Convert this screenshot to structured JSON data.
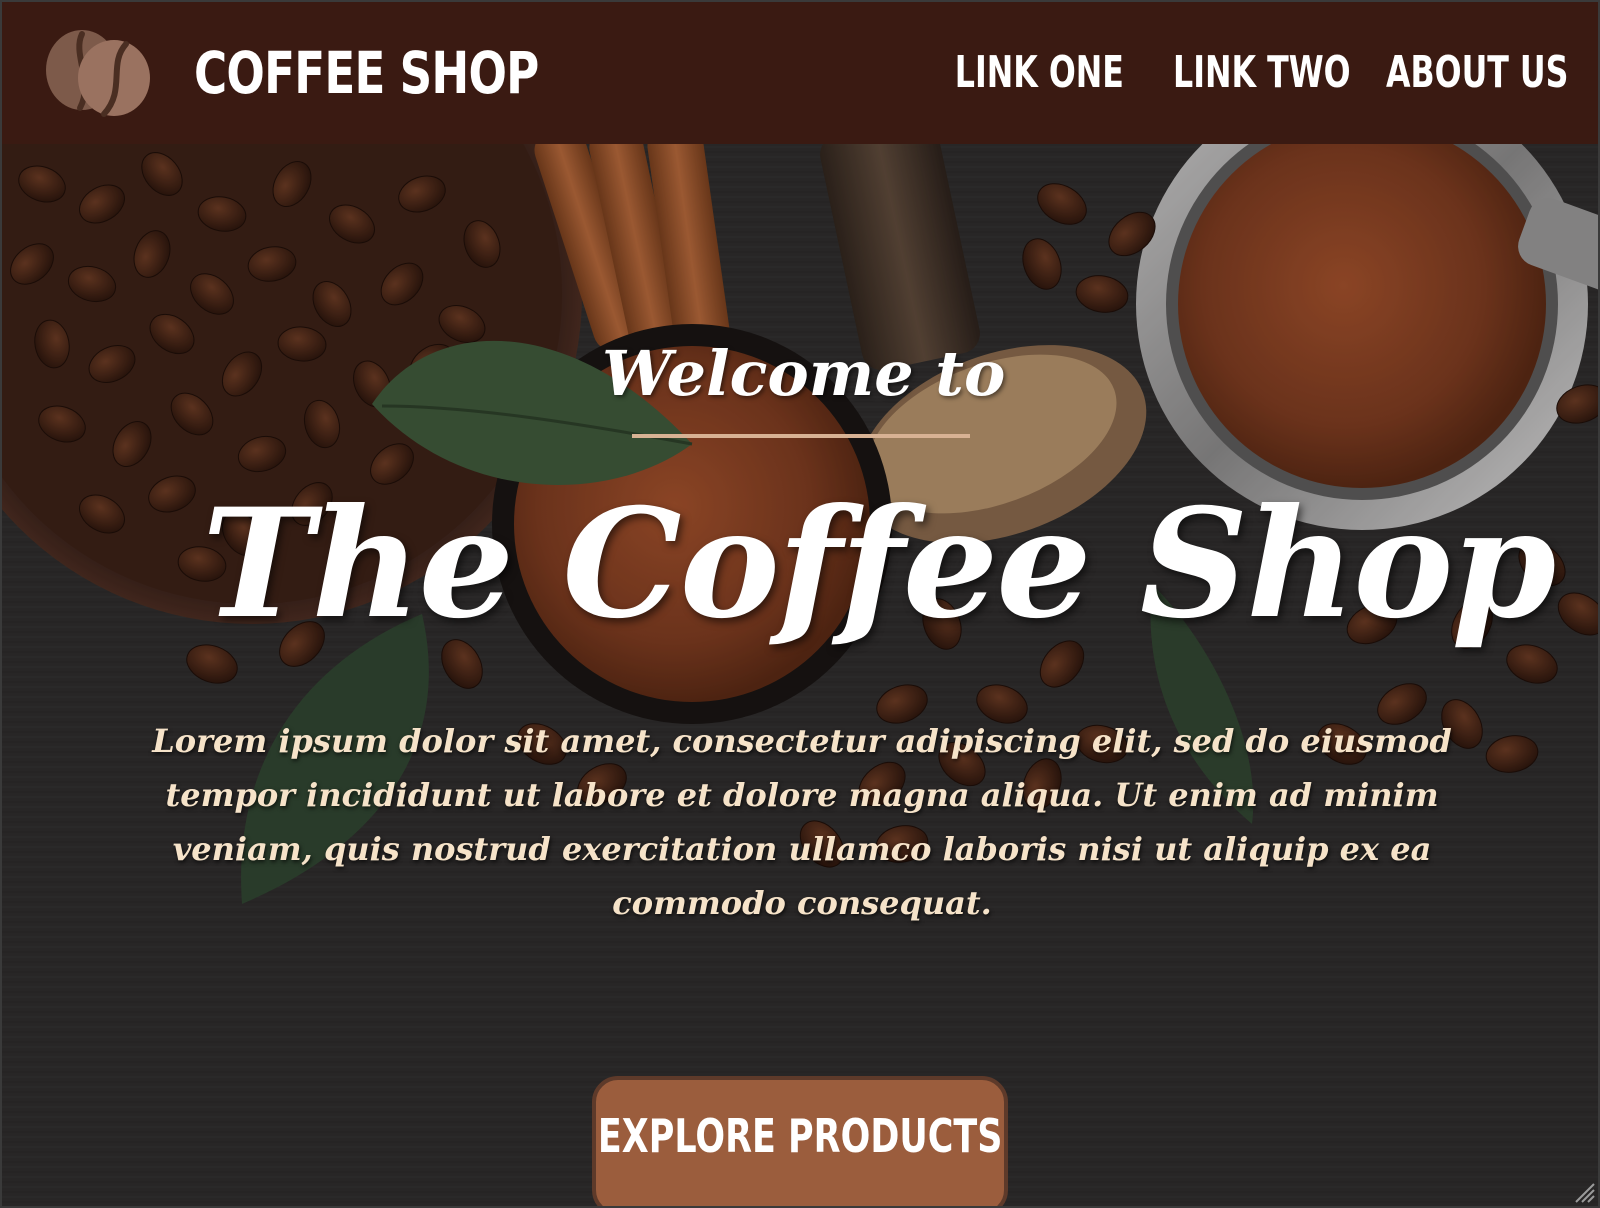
{
  "navbar": {
    "logo_icon": "coffee-beans-icon",
    "brand": "COFFEE SHOP",
    "links": [
      {
        "label": "LINK ONE"
      },
      {
        "label": "LINK TWO"
      },
      {
        "label": "ABOUT US"
      }
    ],
    "background": "#3a1a12"
  },
  "hero": {
    "welcome": "Welcome to",
    "title": "The Coffee Shop",
    "lead": "Lorem ipsum dolor sit amet, consectetur adipiscing elit, sed do eiusmod tempor incididunt ut labore et dolore magna aliqua. Ut enim ad minim veniam, quis nostrud exercitation ullamco laboris nisi ut aliquip ex ea commodo consequat.",
    "cta_label": "EXPLORE PRODUCTS",
    "cta_color": "#9b5d3d",
    "lead_color": "#f6e3c9",
    "rule_color": "#d8b294"
  }
}
